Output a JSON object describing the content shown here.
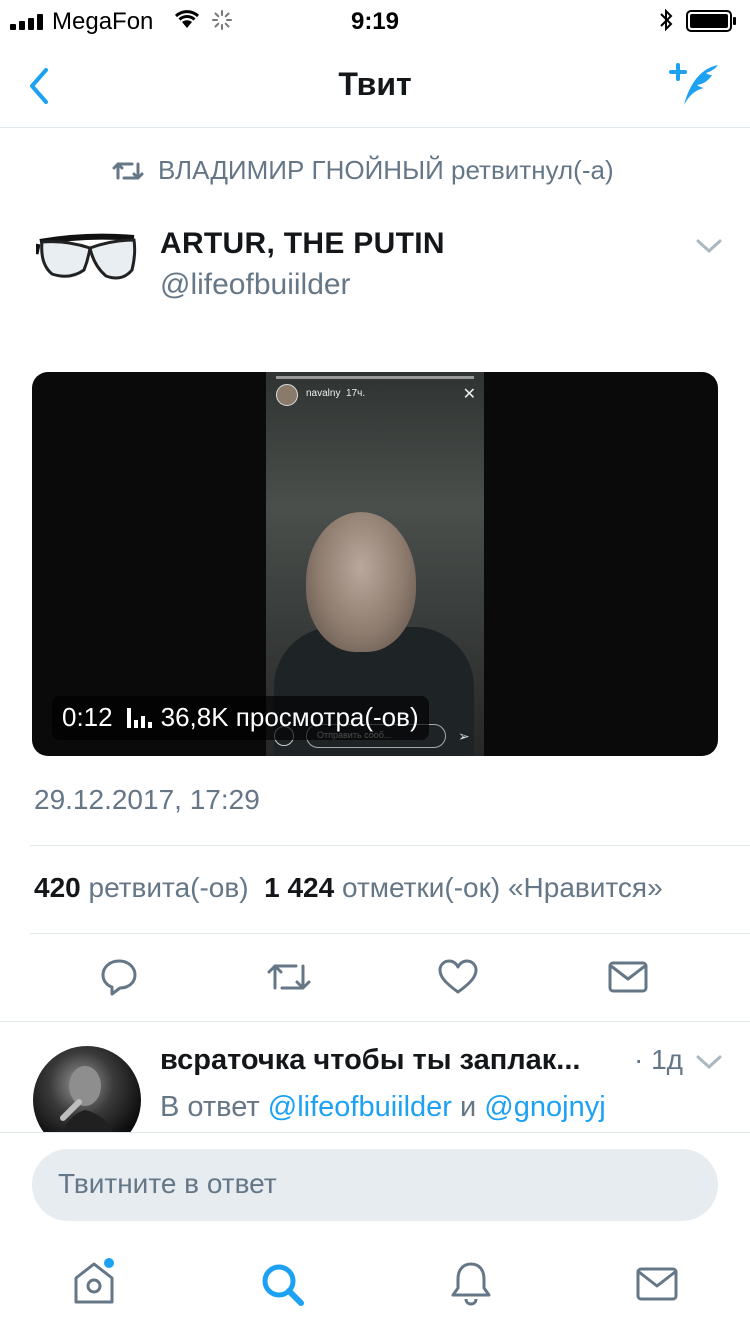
{
  "status_bar": {
    "carrier": "MegaFon",
    "time": "9:19"
  },
  "nav": {
    "title": "Твит",
    "back_icon": "chevron-left-icon",
    "compose_icon": "feather-plus-icon"
  },
  "retweet_context": {
    "icon": "retweet-icon",
    "text": "ВЛАДИМИР ГНОЙНЫЙ ретвитнул(-а)"
  },
  "tweet": {
    "author_name": "ARTUR, THE PUTIN",
    "author_handle": "@lifeofbuiilder",
    "media": {
      "duration": "0:12",
      "views": "36,8K просмотра(-ов)",
      "overlay_user": "navalny",
      "overlay_age": "17ч.",
      "overlay_input": "Отправить сооб..."
    },
    "timestamp": "29.12.2017, 17:29",
    "stats": {
      "retweets_count": "420",
      "retweets_label": "ретвита(-ов)",
      "likes_count": "1 424",
      "likes_label": "отметки(-ок) «Нравится»"
    }
  },
  "actions": [
    "reply-icon",
    "retweet-icon",
    "like-icon",
    "message-icon"
  ],
  "reply": {
    "name": "всраточка чтобы ты заплак...",
    "time": "· 1д",
    "reply_prefix": "В ответ",
    "reply_user1": "@lifeofbuiilder",
    "reply_and": "и",
    "reply_user2": "@gnojnyj"
  },
  "composer": {
    "placeholder": "Твитните в ответ"
  },
  "tabbar": [
    "home-icon",
    "search-icon",
    "notifications-icon",
    "messages-icon"
  ],
  "colors": {
    "accent": "#1da1f2",
    "muted": "#657786",
    "divider": "#e1e8ed"
  }
}
